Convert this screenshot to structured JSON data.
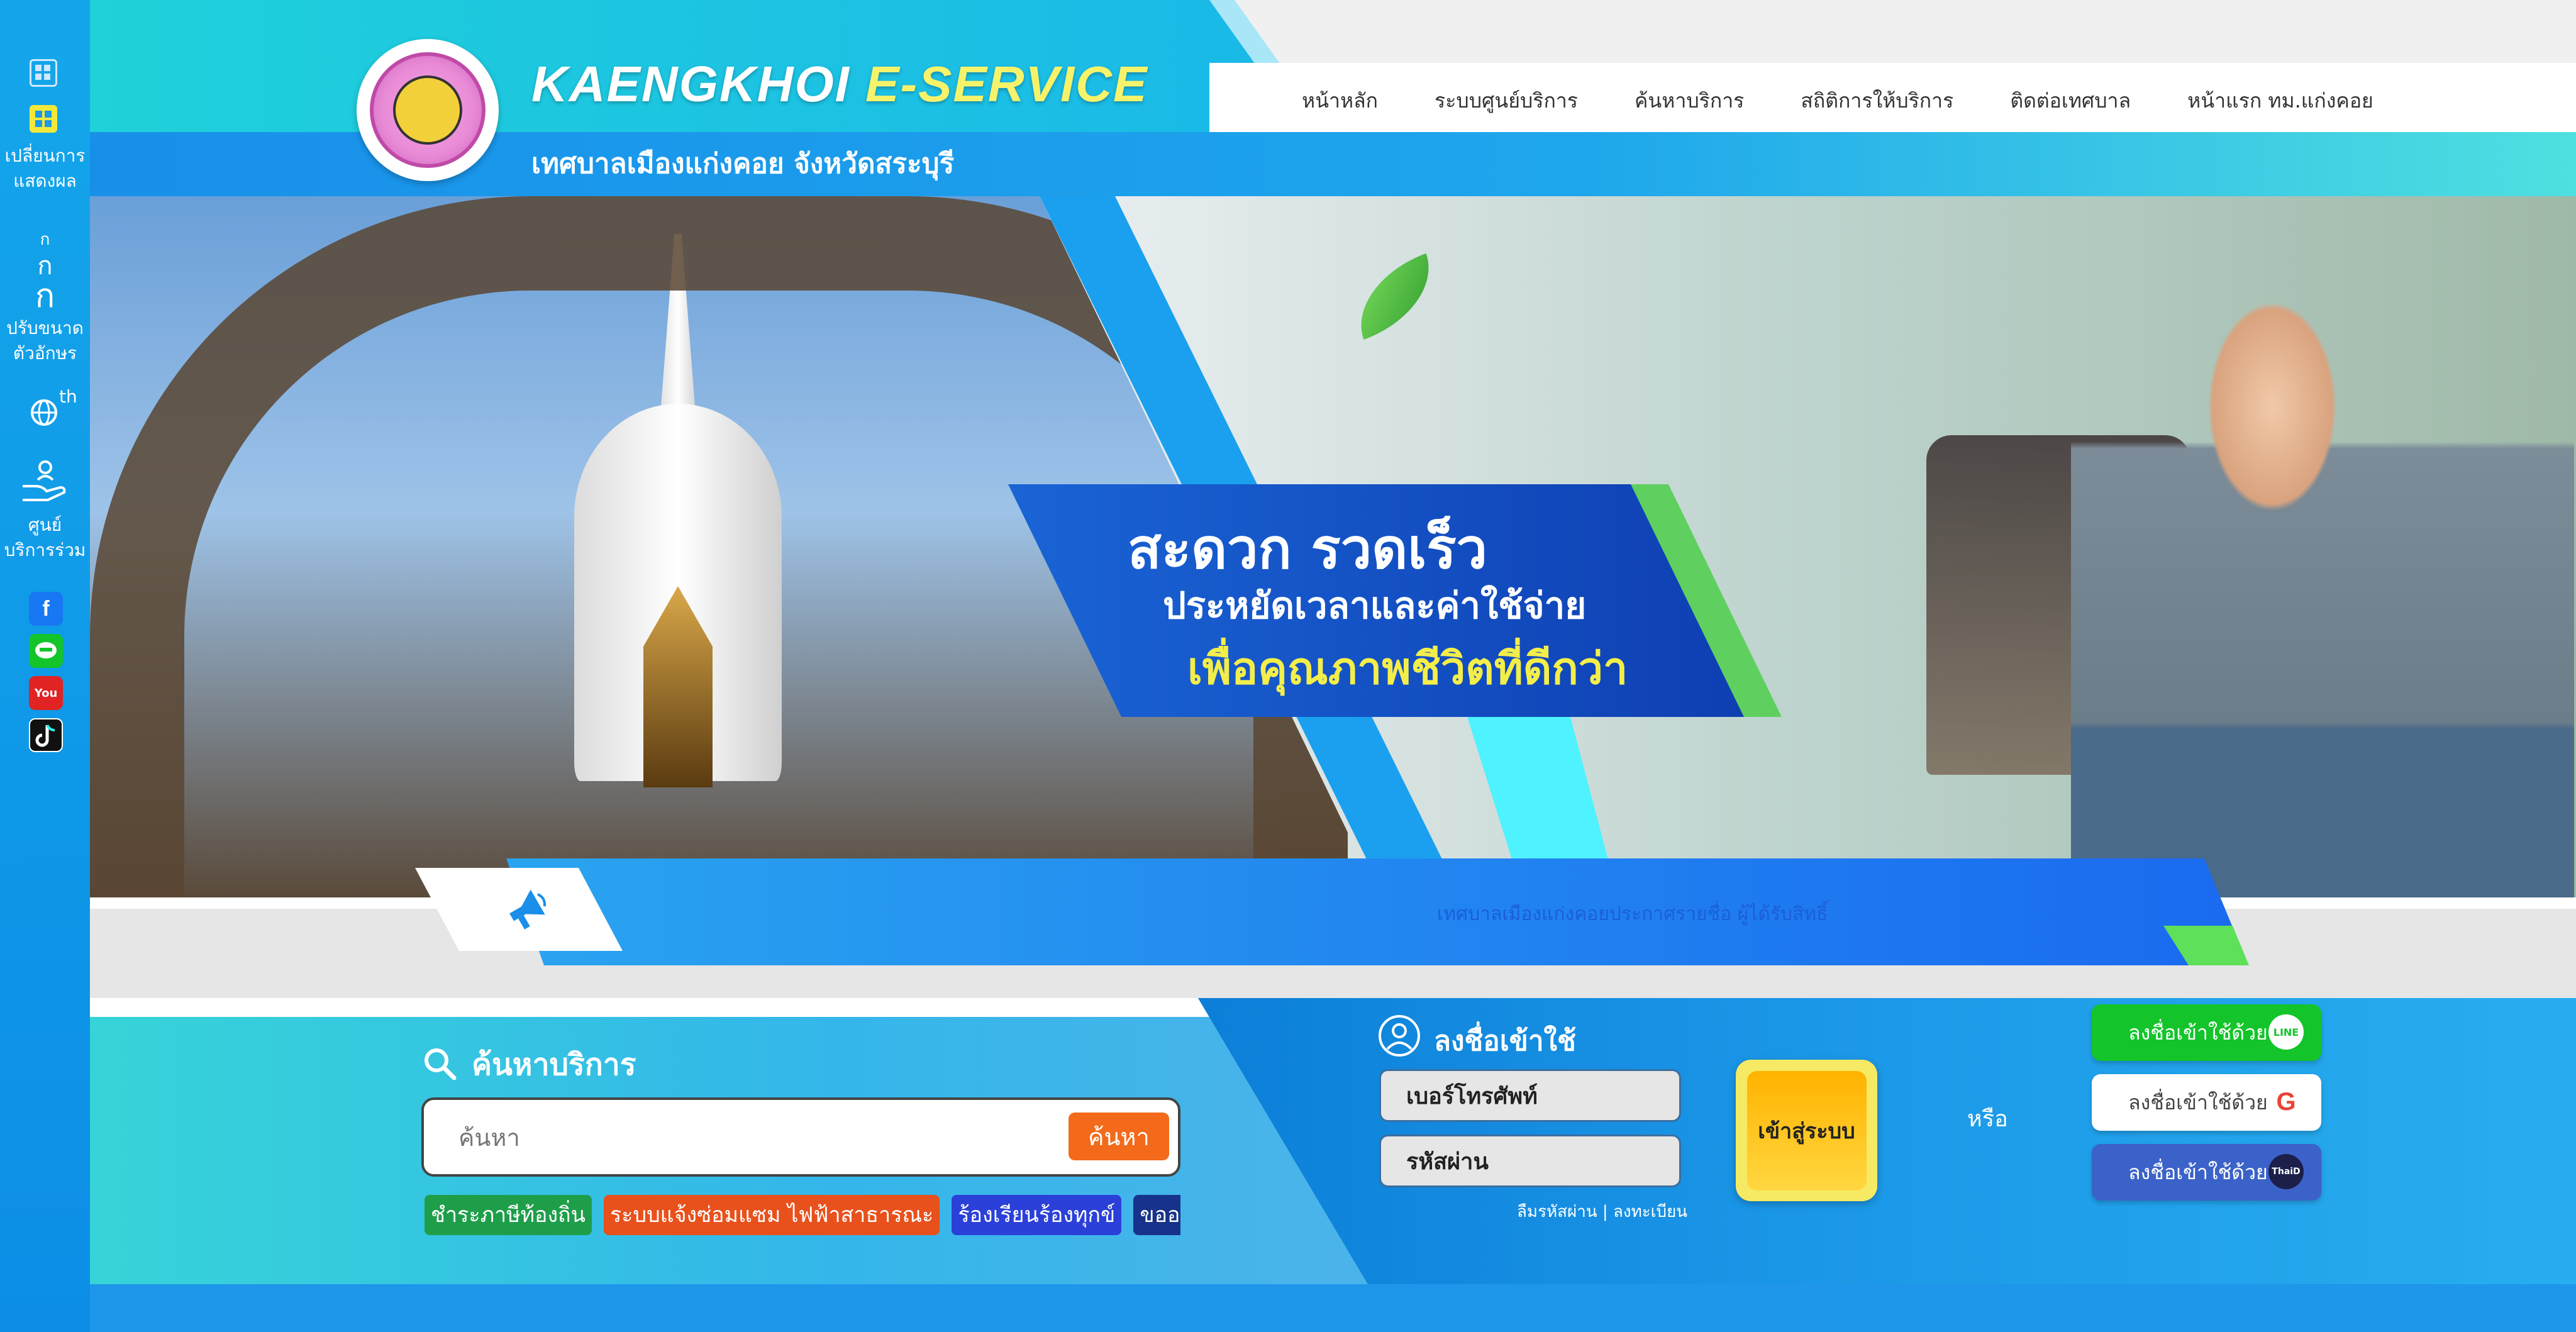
{
  "sidebar": {
    "display_label_1": "เปลี่ยนการ",
    "display_label_2": "แสดงผล",
    "font_glyph_small": "ก",
    "font_glyph_mid": "ก",
    "font_glyph_big": "ก",
    "font_label_1": "ปรับขนาด",
    "font_label_2": "ตัวอักษร",
    "lang_code": "th",
    "center_label_1": "ศูนย์",
    "center_label_2": "บริการร่วม",
    "youtube_text": "You"
  },
  "header": {
    "brand_part1": "KAENGKHOI ",
    "brand_part2": "E-SERVICE",
    "subtitle": "เทศบาลเมืองแก่งคอย จังหวัดสระบุรี",
    "nav": [
      "หน้าหลัก",
      "ระบบศูนย์บริการ",
      "ค้นหาบริการ",
      "สถิติการให้บริการ",
      "ติดต่อเทศบาล",
      "หน้าแรก ทม.แก่งคอย"
    ]
  },
  "banner": {
    "line1": "สะดวก  รวดเร็ว",
    "line2": "ประหยัดเวลาและค่าใช้จ่าย",
    "line3": "เพื่อคุณภาพชีวิตที่ดีกว่า"
  },
  "announcement": {
    "text": "เทศบาลเมืองแก่งคอยประกาศรายชื่อ ผู้ได้รับสิทธิ์"
  },
  "search": {
    "title": "ค้นหาบริการ",
    "placeholder": "ค้นหา",
    "button": "ค้นหา",
    "chips": [
      {
        "label": "ชำระภาษีท้องถิ่น",
        "color": "#1f9e4a"
      },
      {
        "label": "ระบบแจ้งซ่อมแซม ไฟฟ้าสาธารณะ",
        "color": "#e8511c"
      },
      {
        "label": "ร้องเรียนร้องทุกข์",
        "color": "#2b40d8"
      },
      {
        "label": "ขออนุญาตงา",
        "color": "#17328a"
      }
    ]
  },
  "login": {
    "title": "ลงชื่อเข้าใช้",
    "phone_placeholder": "เบอร์โทรศัพท์",
    "password_placeholder": "รหัสผ่าน",
    "forgot": "ลืมรหัสผ่าน | ลงทะเบียน",
    "enter": "เข้าสู่ระบบ",
    "or": "หรือ",
    "line_label": "ลงชื่อเข้าใช้ด้วย",
    "line_icon_text": "LINE",
    "google_label": "ลงชื่อเข้าใช้ด้วย",
    "google_icon_text": "G",
    "thaid_label": "ลงชื่อเข้าใช้ด้วย",
    "thaid_icon_text": "ThaiD"
  },
  "colors": {
    "accent": "#1ea6ec",
    "brand_yellow": "#f6f36a",
    "search_button": "#f36a1a",
    "line_green": "#13c52a",
    "thaid_blue": "#3b62c8"
  }
}
